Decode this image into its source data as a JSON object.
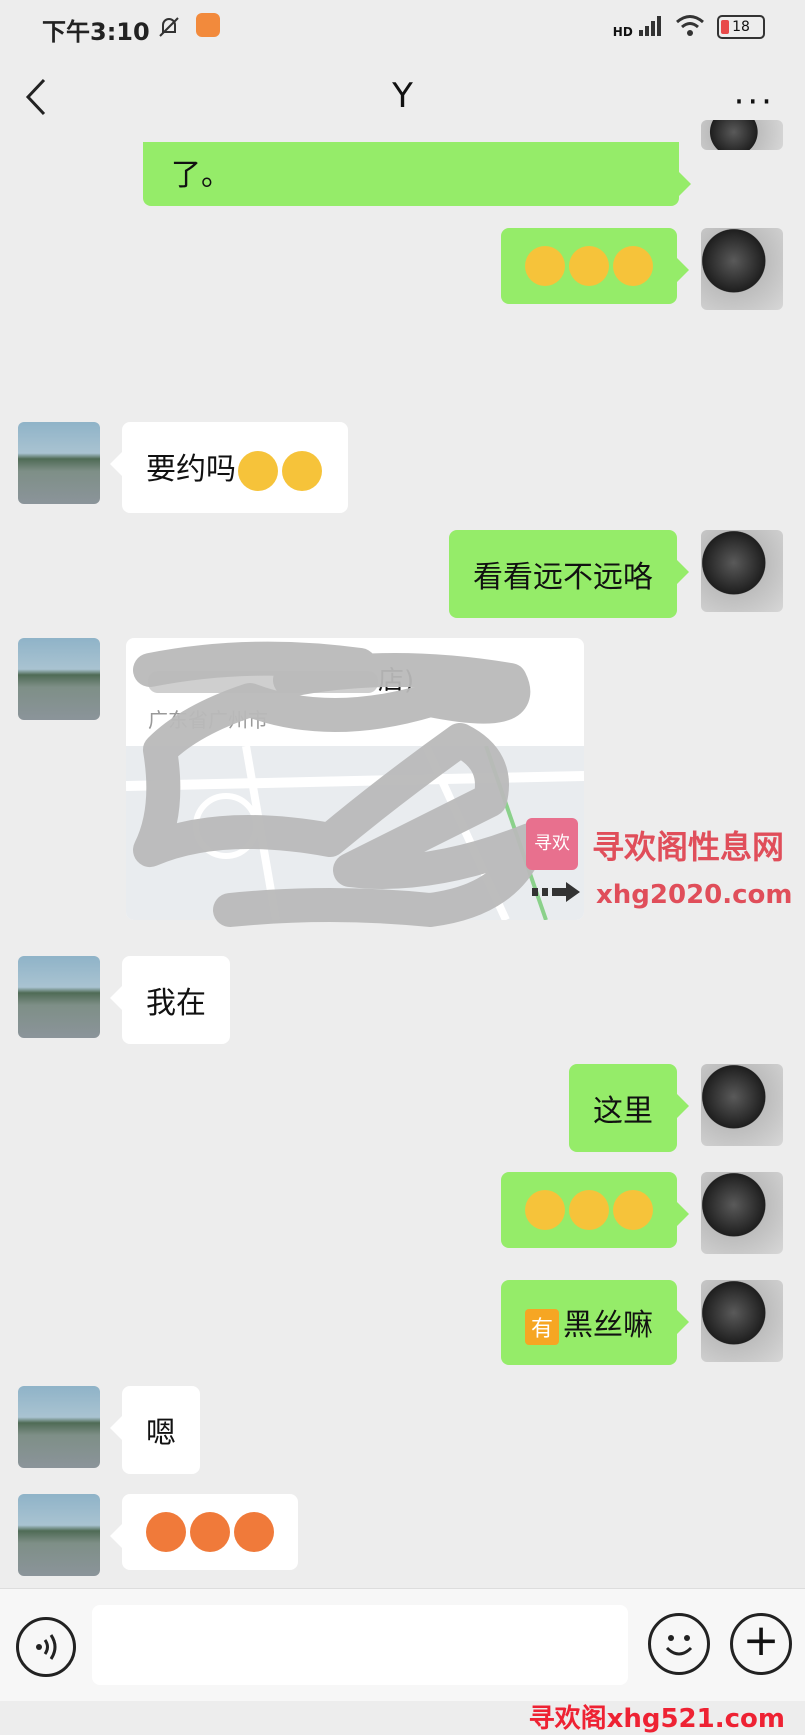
{
  "status": {
    "time": "下午3:10",
    "battery": "18",
    "network": "HD"
  },
  "header": {
    "title": "Y",
    "more": "···"
  },
  "messages": {
    "m0": "了。",
    "m2": "要约吗",
    "m3": "看看远不远咯",
    "m5": "我在",
    "m6": "这里",
    "m8_tag": "有",
    "m8_text": "黑丝嘛",
    "m9": "嗯"
  },
  "location": {
    "name_suffix": "店)",
    "address": "广东省广州市"
  },
  "watermark": {
    "box": "寻欢",
    "text": "寻欢阁性息网",
    "url": "xhg2020.com",
    "bottom": "寻欢阁xhg521.com"
  },
  "colors": {
    "bubble_self": "#95ec69",
    "bubble_other": "#ffffff",
    "background": "#ededed"
  }
}
